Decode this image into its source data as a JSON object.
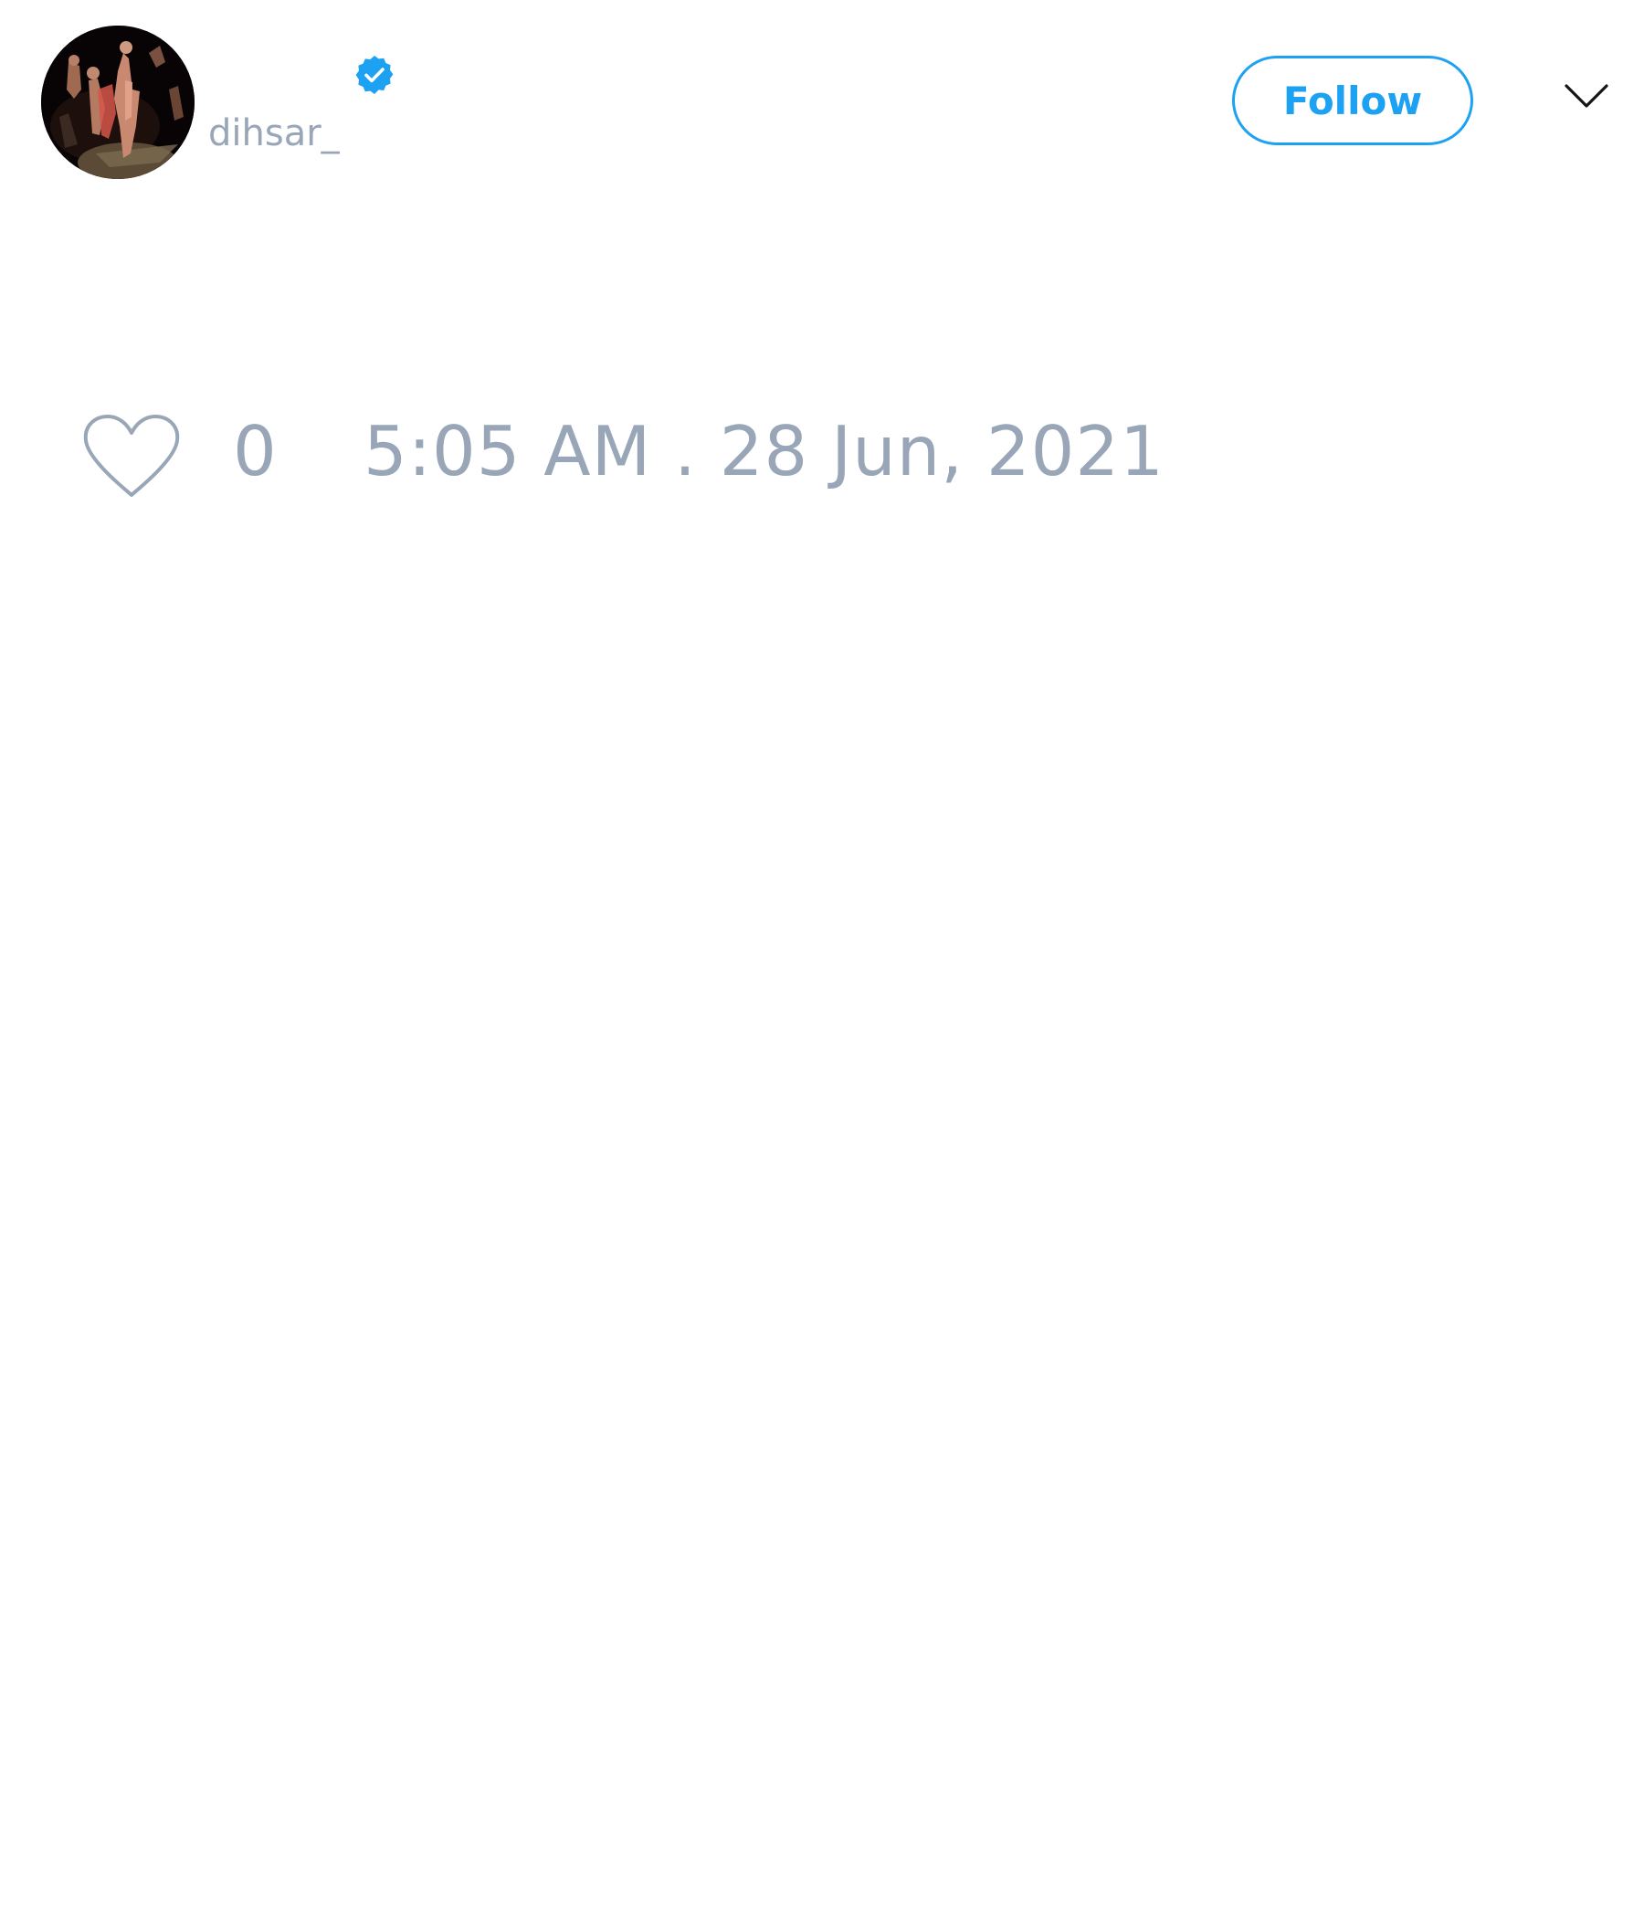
{
  "tweet": {
    "author": {
      "display_name": "",
      "handle": "dihsar_",
      "verified": true,
      "avatar": "dark night photo of people"
    },
    "follow_label": "Follow",
    "menu_icon": "chevron-down-icon",
    "like_icon": "heart-outline-icon",
    "like_count": "0",
    "timestamp": "5:05 AM . 28 Jun, 2021"
  },
  "colors": {
    "accent": "#1da1f2",
    "muted_text": "#98a6b8",
    "background": "#ffffff"
  }
}
